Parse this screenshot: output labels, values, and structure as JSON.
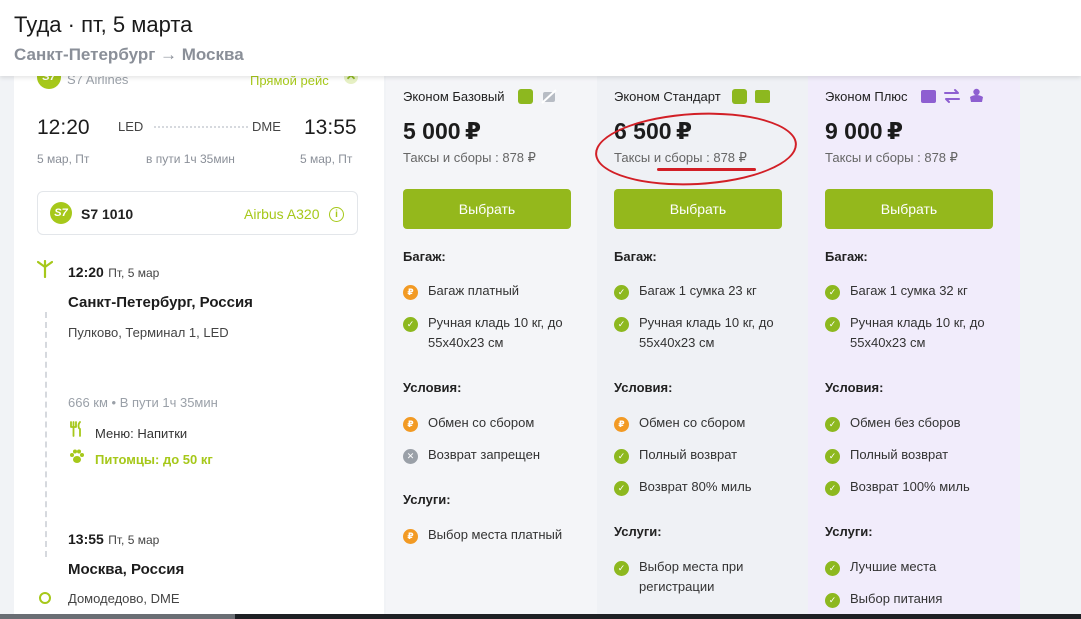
{
  "header": {
    "title": "Туда · пт, 5 марта",
    "route": "Санкт-Петербург → Москва"
  },
  "flight": {
    "airline": "S7 Airlines",
    "airline_logo": "S7",
    "direct_label": "Прямой рейс",
    "dep_time": "12:20",
    "dep_code": "LED",
    "arr_code": "DME",
    "arr_time": "13:55",
    "dep_date": "5 мар, Пт",
    "arr_date": "5 мар, Пт",
    "duration": "в пути 1ч 35мин",
    "flight_number": "S7 1010",
    "aircraft": "Airbus A320",
    "dep_stop_time": "12:20",
    "dep_stop_date": "Пт, 5 мар",
    "dep_city": "Санкт-Петербург, Россия",
    "dep_airport": "Пулково, Терминал 1, LED",
    "distance": "666 км • В пути 1ч 35мин",
    "menu": "Меню: Напитки",
    "pets": "Питомцы: до 50 кг",
    "arr_stop_time": "13:55",
    "arr_stop_date": "Пт, 5 мар",
    "arr_city": "Москва, Россия",
    "arr_airport": "Домодедово, DME"
  },
  "fares": [
    {
      "name": "Эконом Базовый",
      "price": "5 000",
      "currency": "₽",
      "taxes": "Таксы и сборы : 878 ₽",
      "button": "Выбрать",
      "baggage_title": "Багаж:",
      "baggage": [
        {
          "status": "paid",
          "text": "Багаж платный"
        },
        {
          "status": "ok",
          "text": "Ручная кладь 10 кг, до 55x40x23 см"
        }
      ],
      "conditions_title": "Условия:",
      "conditions": [
        {
          "status": "paid",
          "text": "Обмен со сбором"
        },
        {
          "status": "no",
          "text": "Возврат запрещен"
        }
      ],
      "services_title": "Услуги:",
      "services": [
        {
          "status": "paid",
          "text": "Выбор места платный"
        }
      ]
    },
    {
      "name": "Эконом Стандарт",
      "price": "6 500",
      "currency": "₽",
      "taxes": "Таксы и сборы : 878 ₽",
      "button": "Выбрать",
      "baggage_title": "Багаж:",
      "baggage": [
        {
          "status": "ok",
          "text": "Багаж 1 сумка 23 кг"
        },
        {
          "status": "ok",
          "text": "Ручная кладь 10 кг, до 55x40x23 см"
        }
      ],
      "conditions_title": "Условия:",
      "conditions": [
        {
          "status": "paid",
          "text": "Обмен со сбором"
        },
        {
          "status": "ok",
          "text": "Полный возврат"
        },
        {
          "status": "ok",
          "text": "Возврат 80% миль"
        }
      ],
      "services_title": "Услуги:",
      "services": [
        {
          "status": "ok",
          "text": "Выбор места при регистрации"
        }
      ]
    },
    {
      "name": "Эконом Плюс",
      "price": "9 000",
      "currency": "₽",
      "taxes": "Таксы и сборы : 878 ₽",
      "button": "Выбрать",
      "baggage_title": "Багаж:",
      "baggage": [
        {
          "status": "ok",
          "text": "Багаж 1 сумка 32 кг"
        },
        {
          "status": "ok",
          "text": "Ручная кладь 10 кг, до 55x40x23 см"
        }
      ],
      "conditions_title": "Условия:",
      "conditions": [
        {
          "status": "ok",
          "text": "Обмен без сборов"
        },
        {
          "status": "ok",
          "text": "Полный возврат"
        },
        {
          "status": "ok",
          "text": "Возврат 100% миль"
        }
      ],
      "services_title": "Услуги:",
      "services": [
        {
          "status": "ok",
          "text": "Лучшие места"
        },
        {
          "status": "ok",
          "text": "Выбор питания"
        }
      ]
    }
  ],
  "colors": {
    "brand": "#a6c81a",
    "button": "#94b81c",
    "paid": "#f29a24",
    "annotation": "#d21f26"
  }
}
